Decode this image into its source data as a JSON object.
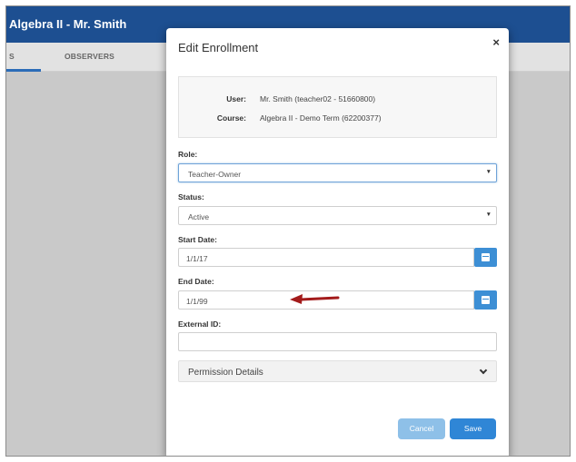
{
  "app": {
    "title": "Algebra II - Mr. Smith"
  },
  "tabs": [
    {
      "label": "S"
    },
    {
      "label": "OBSERVERS"
    }
  ],
  "modal": {
    "title": "Edit Enrollment",
    "close_glyph": "×",
    "info": {
      "user_label": "User:",
      "user_value": "Mr. Smith (teacher02 - 51660800)",
      "course_label": "Course:",
      "course_value": "Algebra II - Demo Term (62200377)"
    },
    "role": {
      "label": "Role:",
      "value": "Teacher-Owner"
    },
    "status": {
      "label": "Status:",
      "value": "Active"
    },
    "start_date": {
      "label": "Start Date:",
      "value": "1/1/17"
    },
    "end_date": {
      "label": "End Date:",
      "value": "1/1/99"
    },
    "external_id": {
      "label": "External ID:",
      "value": ""
    },
    "permission_details": {
      "label": "Permission Details"
    },
    "buttons": {
      "cancel": "Cancel",
      "save": "Save"
    }
  },
  "icons": {
    "close": "close-icon",
    "select_arrow": "caret-down-icon",
    "calendar": "calendar-icon",
    "chevron": "chevron-down-icon"
  },
  "colors": {
    "header": "#1d4f91",
    "primary": "#2f86d6",
    "primary_light": "#8ec0e8",
    "annotation_arrow": "#a31b1b"
  }
}
